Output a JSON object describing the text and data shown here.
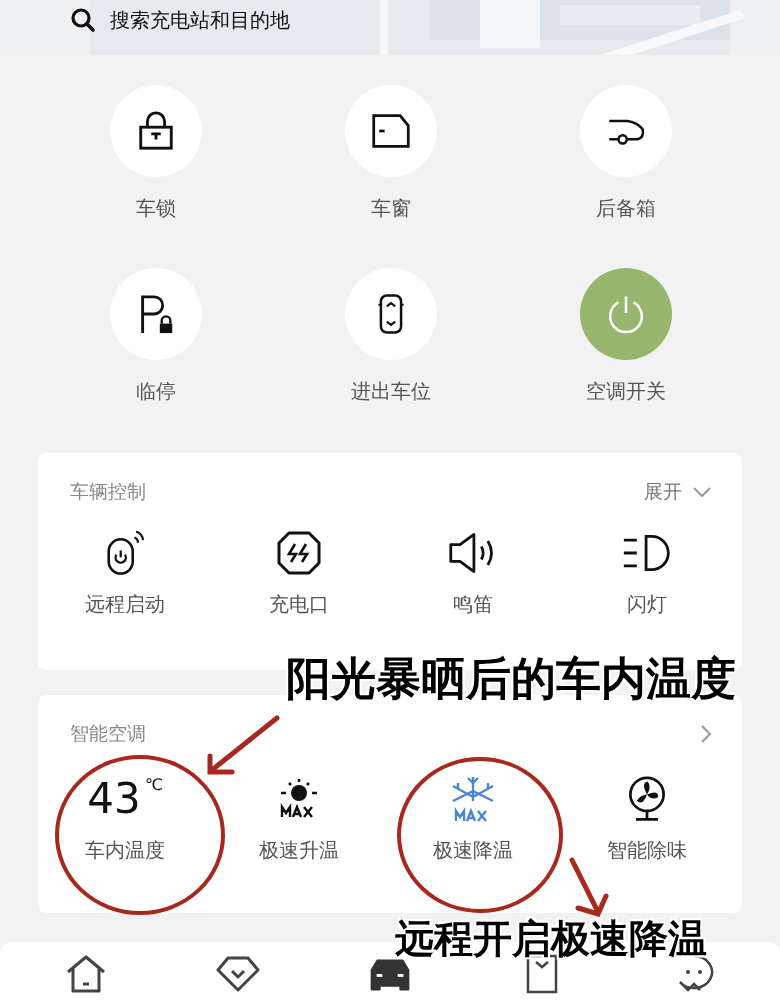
{
  "search": {
    "placeholder": "搜索充电站和目的地"
  },
  "quick_actions": [
    {
      "label": "车锁",
      "on": false
    },
    {
      "label": "车窗",
      "on": false
    },
    {
      "label": "后备箱",
      "on": false
    },
    {
      "label": "临停",
      "on": false
    },
    {
      "label": "进出车位",
      "on": false
    },
    {
      "label": "空调开关",
      "on": true
    }
  ],
  "vehicle_control": {
    "title": "车辆控制",
    "expand": "展开",
    "items": [
      {
        "label": "远程启动"
      },
      {
        "label": "充电口"
      },
      {
        "label": "鸣笛"
      },
      {
        "label": "闪灯"
      }
    ]
  },
  "smart_ac": {
    "title": "智能空调",
    "items": [
      {
        "kind": "temperature",
        "value": "43",
        "unit": "℃",
        "label": "车内温度"
      },
      {
        "kind": "action",
        "label": "极速升温"
      },
      {
        "kind": "action",
        "label": "极速降温"
      },
      {
        "kind": "action",
        "label": "智能除味"
      }
    ]
  },
  "bottom_nav": [
    {
      "selected": false
    },
    {
      "selected": false
    },
    {
      "selected": true
    },
    {
      "selected": false
    },
    {
      "selected": false
    }
  ],
  "annotations": [
    {
      "text": "阳光暴晒后的车内温度"
    },
    {
      "text": "远程开启极速降温"
    }
  ]
}
